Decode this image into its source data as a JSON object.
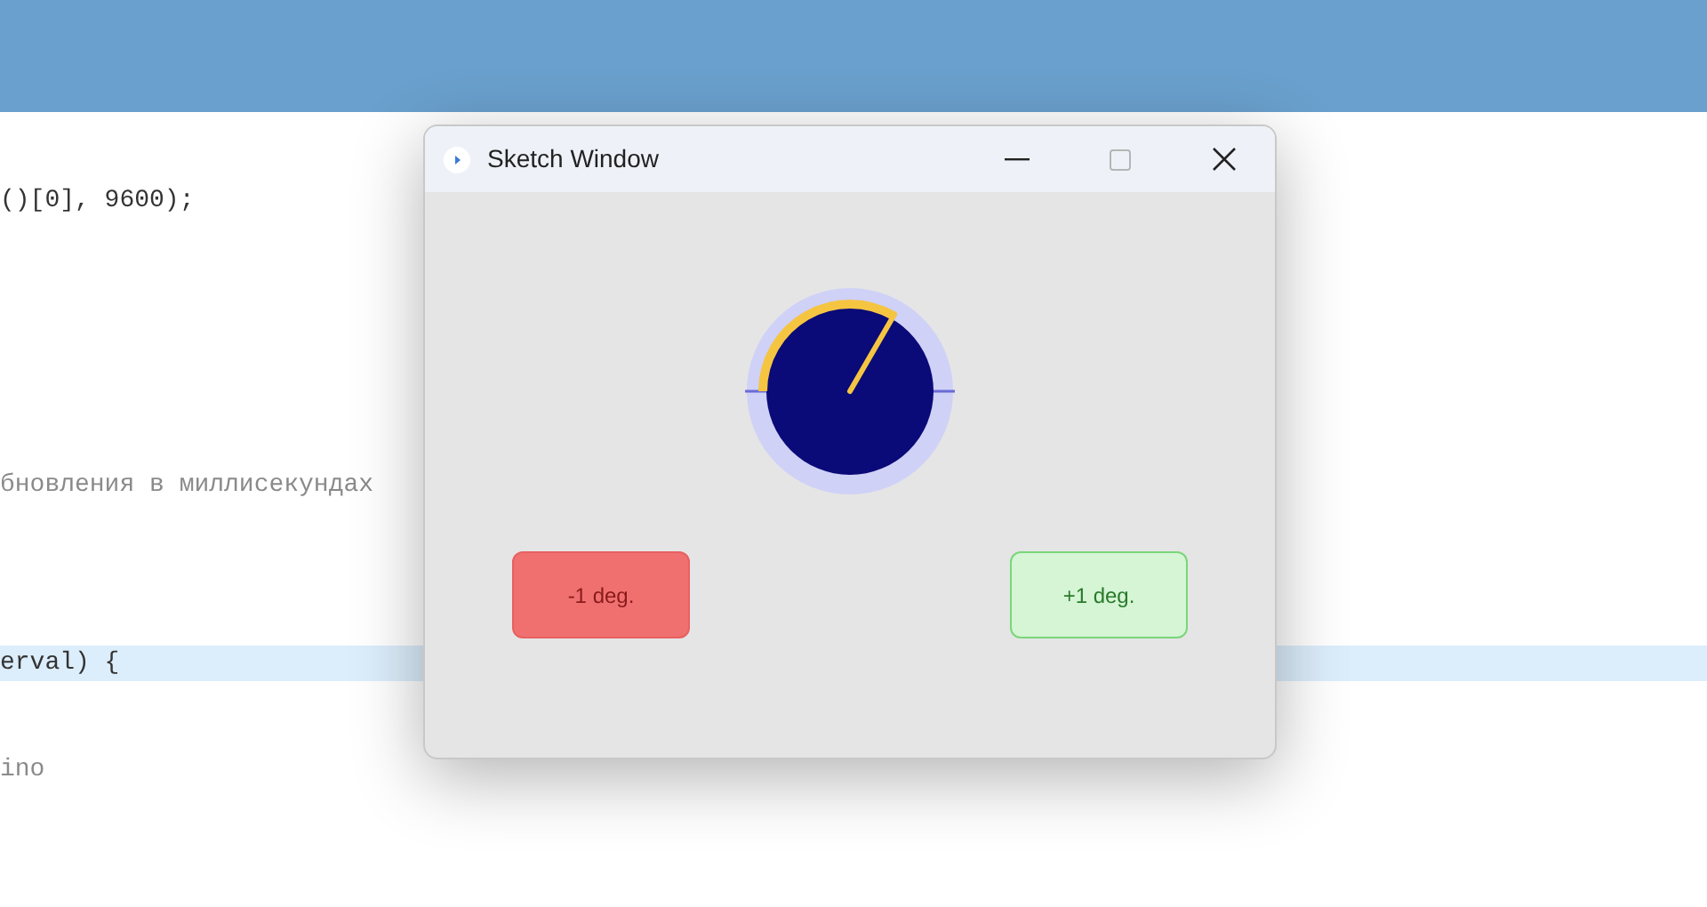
{
  "editor": {
    "lines": [
      {
        "text": "()[0], 9600);",
        "kind": "code",
        "selected": false
      },
      {
        "text": "бновления в миллисекундах",
        "kind": "comment",
        "selected": false
      },
      {
        "text": "erval) {",
        "kind": "code",
        "selected": true
      },
      {
        "text": "ino",
        "kind": "comment",
        "selected": false
      }
    ]
  },
  "window": {
    "title": "Sketch Window",
    "maximize_disabled": true,
    "buttons": [
      {
        "label": "-1 deg.",
        "kind": "decrease"
      },
      {
        "label": "+1 deg.",
        "kind": "increase"
      }
    ]
  }
}
